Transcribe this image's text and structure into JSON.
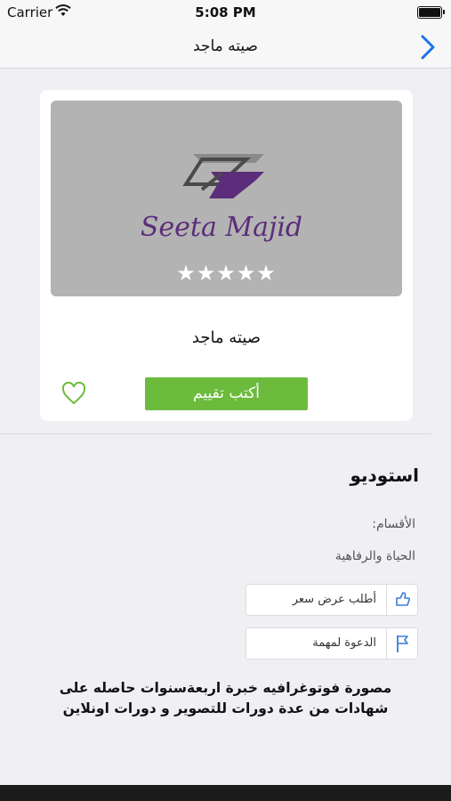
{
  "status_bar": {
    "carrier": "Carrier",
    "time": "5:08 PM"
  },
  "nav": {
    "title": "صيته ماجد",
    "back_icon": "chevron-right-icon"
  },
  "card": {
    "logo_text": "Seeta Majid",
    "rating": {
      "value": 5,
      "max": 5,
      "stars": "★★★★★"
    },
    "name": "صيته ماجد",
    "write_review_label": "أكتب تقييم",
    "favorite_icon": "heart-outline-icon"
  },
  "details": {
    "section_title": "استوديو",
    "categories_label": "الأقسام:",
    "categories_value": "الحياة والرفاهية",
    "actions": [
      {
        "label": "أطلب عرض سعر",
        "icon": "thumbs-up-icon"
      },
      {
        "label": "الدعوة لمهمة",
        "icon": "flag-icon"
      }
    ],
    "description": "مصورة فوتوغرافيه خبرة اربعةسنوات حاصله على شهادات من عدة دورات للتصوير و دورات اونلاين"
  },
  "colors": {
    "accent": "#1a73e8",
    "green_button": "#6cbb3c",
    "purple_logo": "#5b2d7a"
  }
}
